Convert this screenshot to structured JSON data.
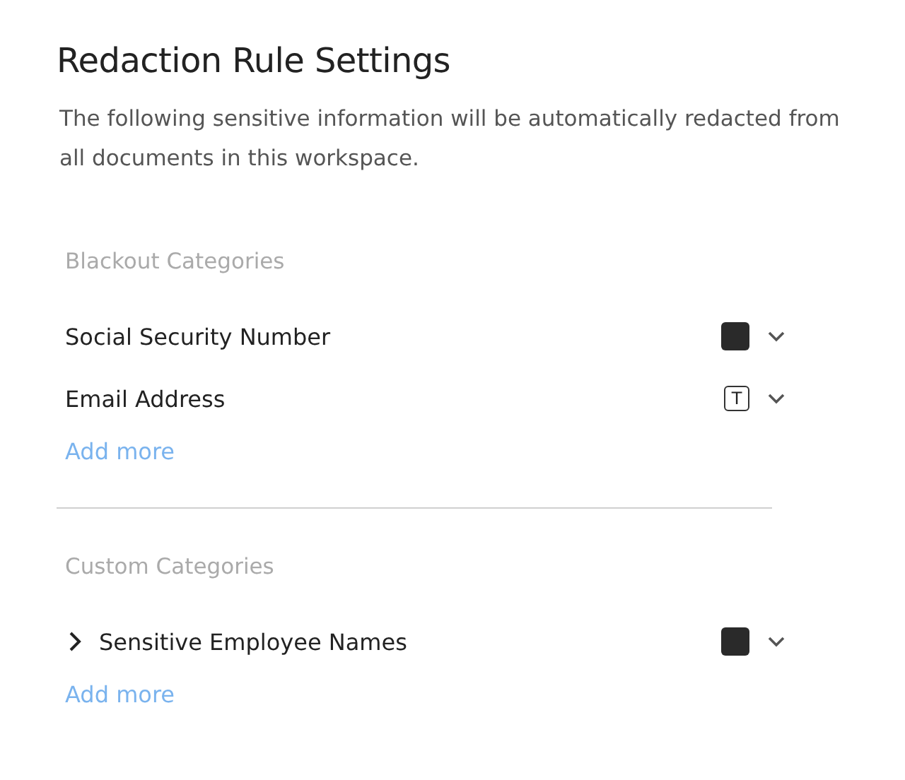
{
  "title": "Redaction Rule Settings",
  "description": "The following sensitive information will be automatically redacted from all documents in this workspace.",
  "sections": [
    {
      "heading": "Blackout Categories",
      "items": [
        {
          "name": "Social Security Number",
          "style": {
            "kind": "fill"
          }
        },
        {
          "name": "Email Address",
          "style": {
            "kind": "text",
            "label": "T"
          }
        }
      ],
      "add_link": "Add more"
    },
    {
      "heading": "Custom Categories",
      "items": [
        {
          "name": "Sensitive Employee Names",
          "expanded": false,
          "style": {
            "kind": "fill"
          }
        }
      ],
      "add_link": "Add more"
    }
  ]
}
